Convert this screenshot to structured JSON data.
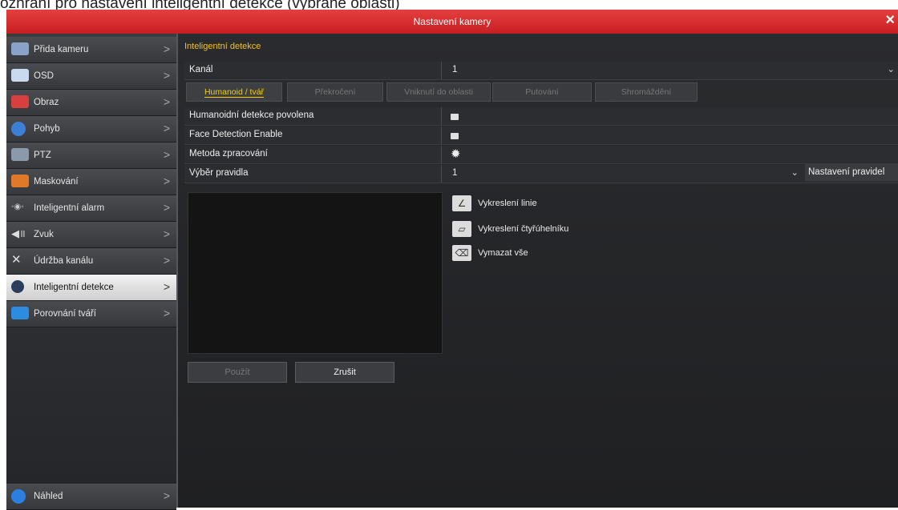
{
  "caption": "ozhraní pro nastavení inteligentní detekce (vybrané oblasti)",
  "window": {
    "title": "Nastavení kamery",
    "close": "×"
  },
  "sidebar": {
    "items": [
      {
        "label": "Přida kameru"
      },
      {
        "label": "OSD"
      },
      {
        "label": "Obraz"
      },
      {
        "label": "Pohyb"
      },
      {
        "label": "PTZ"
      },
      {
        "label": "Maskování"
      },
      {
        "label": "Inteligentní alarm"
      },
      {
        "label": "Zvuk"
      },
      {
        "label": "Údržba kanálu"
      },
      {
        "label": "Inteligentní detekce"
      },
      {
        "label": "Porovnání tváří"
      }
    ],
    "bottom": {
      "label": "Náhled"
    },
    "chevron": ">"
  },
  "section": {
    "title": "Inteligentní detekce"
  },
  "channel": {
    "label": "Kanál",
    "value": "1"
  },
  "tabs": [
    "Humanoid / tvář",
    "Překročení",
    "Vniknutí do oblasti",
    "Putování",
    "Shromáždění"
  ],
  "settings": {
    "humanoid_label": "Humanoidní detekce povolena",
    "face_label": "Face Detection Enable",
    "method_label": "Metoda zpracování",
    "rule_label": "Výběr pravidla",
    "rule_value": "1",
    "preset_button": "Nastavení pravidel"
  },
  "tools": {
    "draw_line": "Vykreslení linie",
    "draw_quad": "Vykreslení čtyřúhelníku",
    "clear_all": "Vymazat vše"
  },
  "buttons": {
    "apply": "Použít",
    "cancel": "Zrušit"
  },
  "colors": {
    "title_bar": "#d42a2c",
    "accent": "#f5d000"
  }
}
